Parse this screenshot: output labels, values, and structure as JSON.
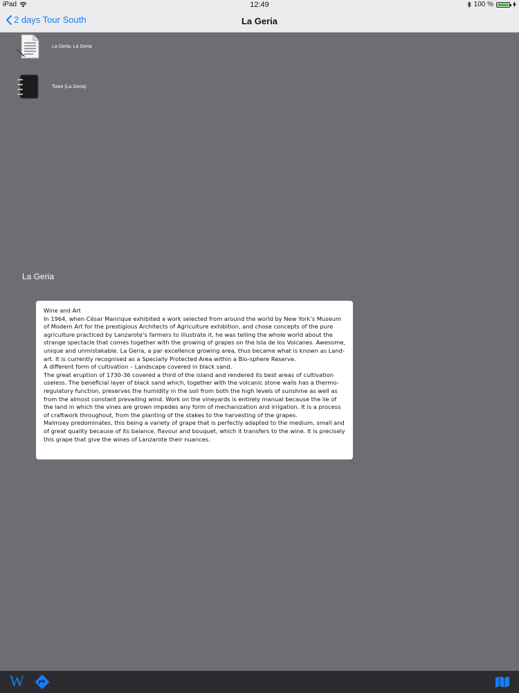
{
  "status_bar": {
    "device": "iPad",
    "time": "12:49",
    "battery_text": "100 %"
  },
  "nav": {
    "back_label": "2 days Tour South",
    "title": "La Geria"
  },
  "items": [
    {
      "label": "La Geria. La Geria",
      "icon": "document-icon"
    },
    {
      "label": "Town (La Geria)",
      "icon": "notebook-icon"
    }
  ],
  "section_title": "La Geria",
  "description": [
    "Wine and Art",
    "In 1964, when César Manrique exhibited a work selected from around the world by New York’s Museum of Modern Art for the prestigious Architects of Agriculture exhibition, and chose concepts of the pure agriculture practiced by Lanzarote’s farmers to illustrate it, he was telling the whole world about the strange spectacle that comes together with the growing of grapes on the Isla de los Volcanes. Awesome, unique and unmistakable. La Geria, a par excellence growing area, thus became what is known as Land-art. It is currently recognised as a Specially Protected Area within a Bio-sphere Reserve.",
    "A different form of cultivation – Landscape covered in black sand.",
    "The great eruption of 1730-36 covered a third of the island and rendered its best areas of cultivation useless. The beneficial layer of black sand which, together with the volcanic stone walls has a thermo-regulatory function, preserves the humidity in the soil from both the high levels of sunshine as well as from the almost constant prevailing wind. Work on the vineyards is entirely manual because the lie of the land in which the vines are grown impedes any form of mechanization and irrigation. It is a process of craftwork throughout, from the planting of the stakes to the harvesting of the grapes.",
    "Malmsey predominates, this being a variety of grape that is perfectly adapted to the medium, small and of great quality because of its balance, flavour and bouquet, which it transfers to the wine. It is precisely this grape that give the wines of Lanzarote their nuances."
  ],
  "toolbar": {
    "wikipedia_label": "W",
    "icons": [
      "wikipedia-icon",
      "directions-icon",
      "map-icon"
    ]
  },
  "colors": {
    "accent": "#1a7bf2",
    "background": "#6d6d73",
    "toolbar": "#2c2c30",
    "battery": "#3cc14b"
  }
}
